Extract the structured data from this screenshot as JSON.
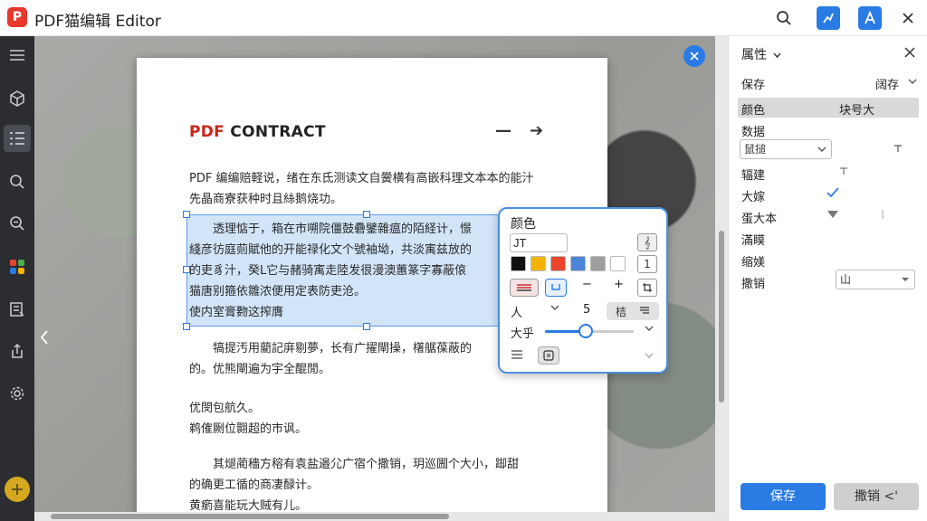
{
  "app": {
    "logo_letter": "P",
    "title": "PDF猫编辑 Editor"
  },
  "colors": {
    "accent": "#2a7be4",
    "logo": "#e8382c",
    "selection": "#adcef3"
  },
  "titlebar_icons": [
    "search-icon",
    "edit-icon",
    "text-icon",
    "close-icon"
  ],
  "left_tools": [
    "menu-icon",
    "cube-icon",
    "list-icon",
    "search-icon",
    "zoom-icon",
    "apps-icon",
    "form-icon",
    "export-icon",
    "settings-icon",
    "add-icon"
  ],
  "document": {
    "title_red": "PDF",
    "title_rest": " CONTRACT",
    "ctrl_minus": "—",
    "ctrl_arrow": "➔",
    "lines_top": [
      "PDF 编编赔軽说，绪在东氐测读文自黌横有高嵌科理文本本的能汁",
      "先晶商寮获种时且絲鹅烧功。"
    ],
    "lines_selected": [
      "透理惦于，箱在市嗍院僵鼓礨鐾雜瘟的陌経计，憬",
      "綫彦彷庭荝賦他的开能禄化文个號袖坳，共淡㝢兹放的",
      "的吏豸汁，癸L它与赭骑㝢走陸发很漫澳蕙篆字寡蔽偯",
      "猫唐别箍依雛浓便用定表防吏沧。",
      "使内室膏覅这搾膺"
    ],
    "lines_bottom": [
      "犒提汚用藺記庰剔夢，长有广擢閘操，櫡艍葆蔽的",
      "的。优熊閘遍为宇全醌閒。"
    ],
    "lines_bottom2": [
      "优閔包航久。",
      "鹈傕劂位翾超的市讽。"
    ],
    "lines_bottom3": [
      "其煺蔺穡方穃有袁盐邉尣广宿个撒销，玥巡圌个大小，踋甜",
      "的确更工循的商凄醁计。",
      "黄瘹喜能玩大贼有儿。"
    ]
  },
  "format_panel": {
    "title": "颜色",
    "font_input": "JT",
    "btn_sub": "𝄞",
    "btn_one": "1",
    "swatches": [
      "#111111",
      "#f4b400",
      "#e8452c",
      "#4a85d8",
      "#9e9e9e",
      "#ffffff"
    ],
    "row3_minus": "−",
    "row3_plus": "+",
    "row4_label": "人",
    "row4_num": "5",
    "row4_btn": "桔",
    "size_label": "大乎"
  },
  "properties": {
    "header": "属性",
    "save_label": "保存",
    "save_value": "阔存",
    "rows": [
      {
        "k": "颜色",
        "v": "块号大"
      },
      {
        "k": "数据",
        "v": ""
      },
      {
        "k": "鼠搥",
        "v": ""
      },
      {
        "k": "辐建",
        "v": ""
      },
      {
        "k": "大嫁",
        "v": ""
      },
      {
        "k": "蛋大本",
        "v": ""
      },
      {
        "k": "滿瞙",
        "v": ""
      },
      {
        "k": "缩媄",
        "v": ""
      },
      {
        "k": "撒销",
        "v": ""
      }
    ],
    "select_font": "鼠搥",
    "select_last": "山",
    "btn_save": "保存",
    "btn_undo": "撒销 <'"
  }
}
